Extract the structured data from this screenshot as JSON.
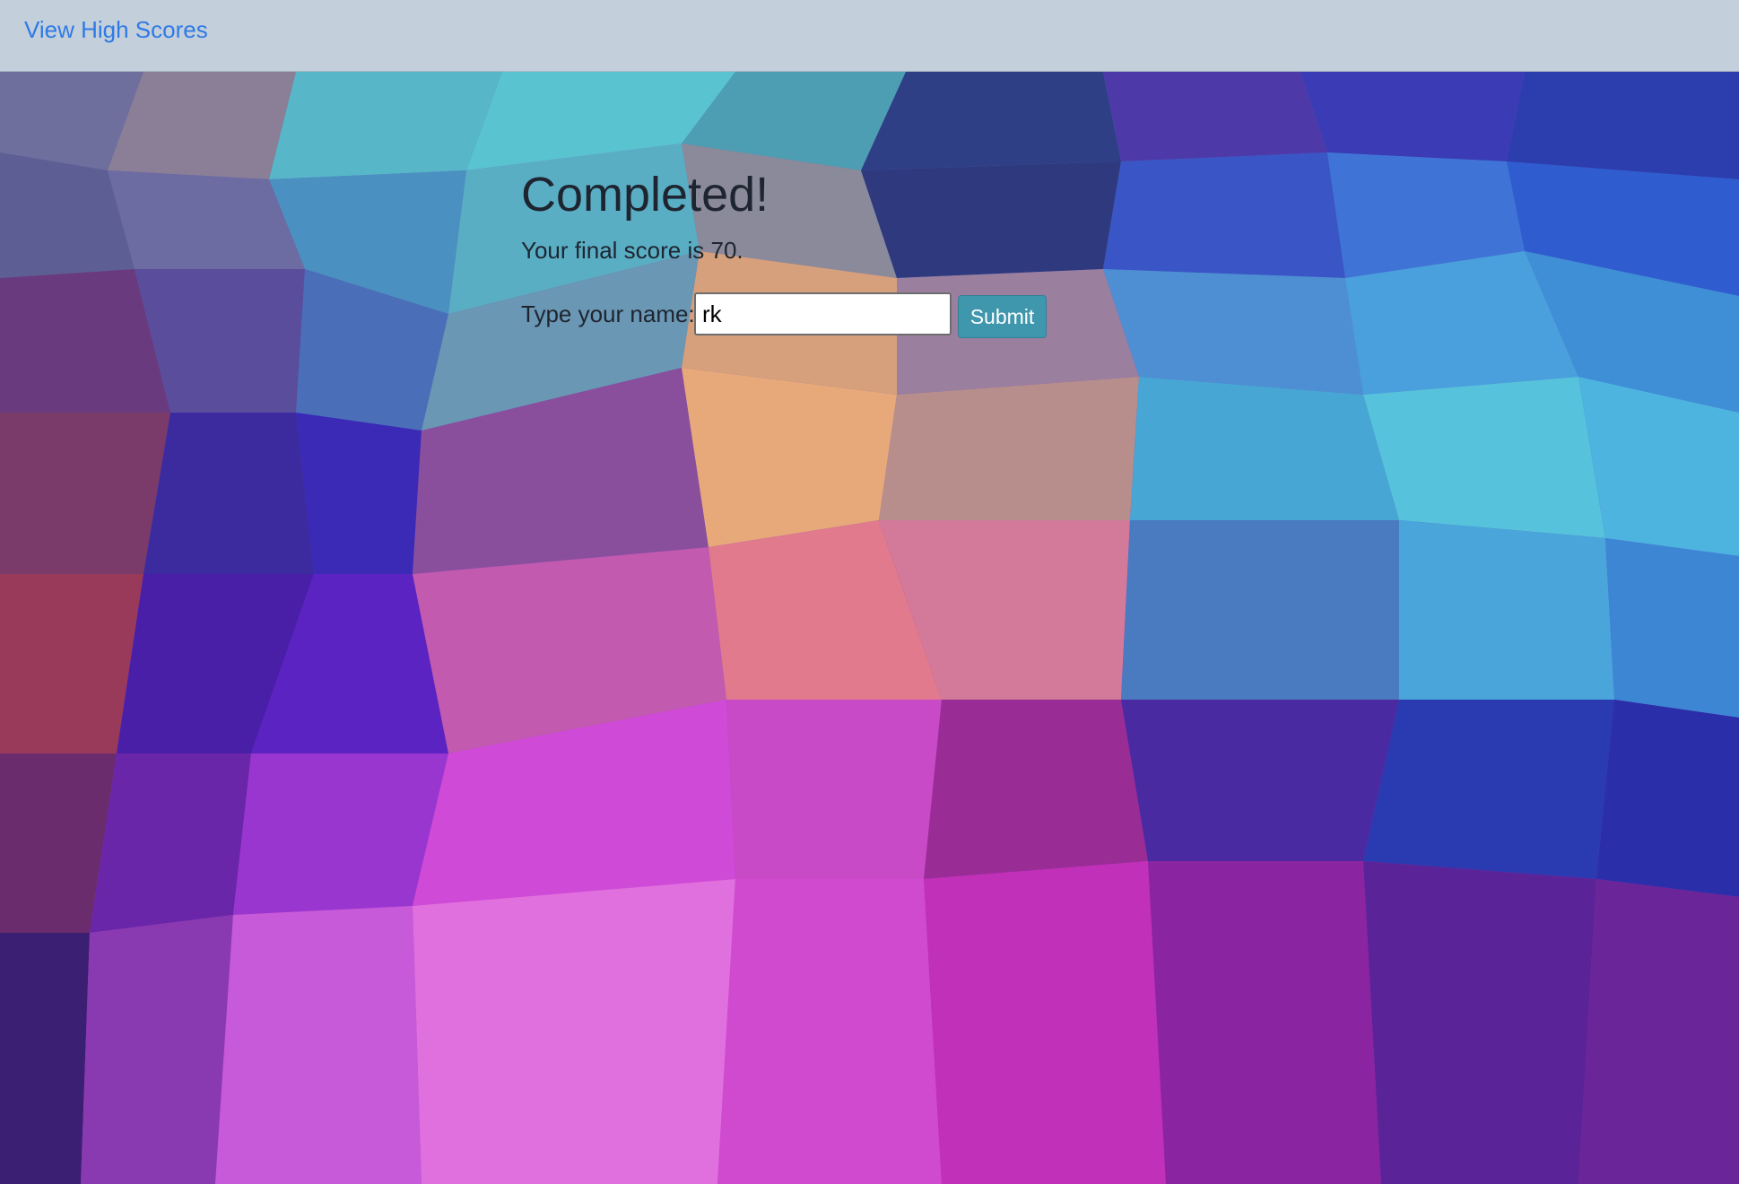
{
  "nav": {
    "high_scores_link": "View High Scores"
  },
  "result": {
    "title": "Completed!",
    "score_text": "Your final score is 70."
  },
  "form": {
    "name_label": "Type your name:",
    "name_value": "rk",
    "submit_label": "Submit"
  },
  "colors": {
    "navbar_bg": "#c3cfdb",
    "link": "#2f7ae5",
    "submit_bg": "#3f97ad",
    "text": "#1e2530"
  }
}
